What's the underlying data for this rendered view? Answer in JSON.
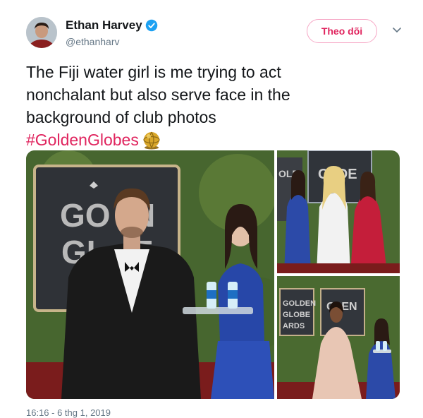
{
  "author": {
    "display_name": "Ethan Harvey",
    "handle": "@ethanharv",
    "verified": true,
    "avatar_icon": "user-avatar"
  },
  "actions": {
    "follow_label": "Theo dõi",
    "more_icon": "chevron-down-icon"
  },
  "tweet": {
    "lines": [
      "The Fiji water girl is me trying to act",
      "nonchalant but also serve face in the",
      "background of club photos"
    ],
    "hashtag": "#GoldenGlobes",
    "hashflag_icon": "golden-globe-hashflag-icon"
  },
  "media": {
    "photos": [
      {
        "name": "photo-main",
        "description_icon": "red-carpet-photo"
      },
      {
        "name": "photo-top-right",
        "description_icon": "red-carpet-photo"
      },
      {
        "name": "photo-bottom-right",
        "description_icon": "red-carpet-photo"
      }
    ]
  },
  "timestamp": "16:16 - 6 thg 1, 2019",
  "colors": {
    "accent": "#e0245e",
    "verified_blue": "#1da1f2",
    "secondary_text": "#657786",
    "follow_border": "#f6a7c5"
  }
}
